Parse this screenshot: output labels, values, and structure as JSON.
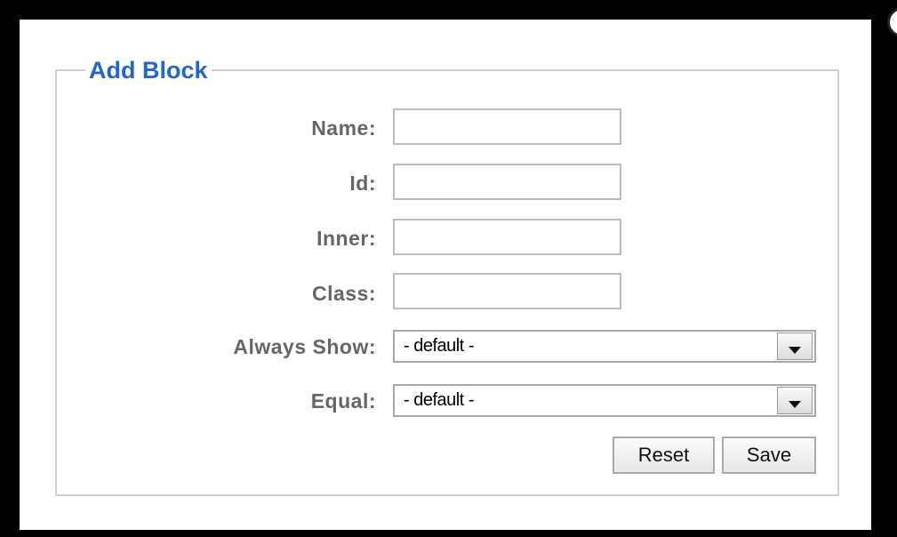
{
  "dialog": {
    "close_glyph": "×",
    "legend": "Add Block",
    "fields": {
      "name_label": "Name:",
      "id_label": "Id:",
      "inner_label": "Inner:",
      "class_label": "Class:",
      "always_show_label": "Always Show:",
      "equal_label": "Equal:",
      "name_value": "",
      "id_value": "",
      "inner_value": "",
      "class_value": "",
      "always_show_value": "- default -",
      "equal_value": "- default -"
    },
    "buttons": {
      "reset_label": "Reset",
      "save_label": "Save"
    }
  },
  "colors": {
    "legend": "#2266cc",
    "label": "#666666",
    "backdrop": "#000000"
  },
  "icons": {
    "close": "close-icon",
    "dropdown": "chevron-down-icon"
  }
}
